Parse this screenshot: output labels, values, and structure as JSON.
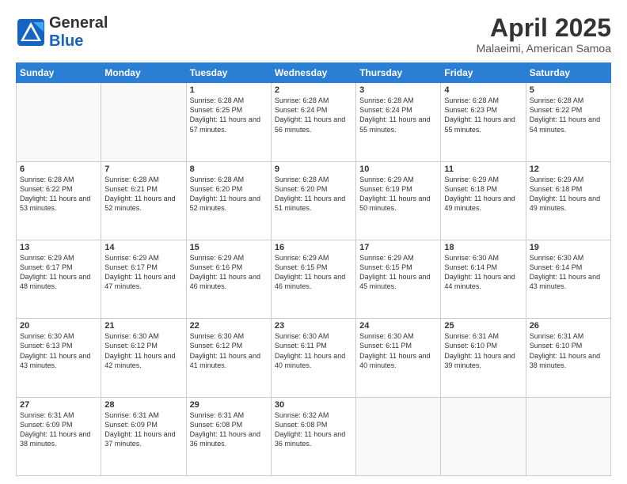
{
  "header": {
    "logo_general": "General",
    "logo_blue": "Blue",
    "month_title": "April 2025",
    "location": "Malaeimi, American Samoa"
  },
  "days_of_week": [
    "Sunday",
    "Monday",
    "Tuesday",
    "Wednesday",
    "Thursday",
    "Friday",
    "Saturday"
  ],
  "weeks": [
    [
      {
        "day": "",
        "info": ""
      },
      {
        "day": "",
        "info": ""
      },
      {
        "day": "1",
        "info": "Sunrise: 6:28 AM\nSunset: 6:25 PM\nDaylight: 11 hours and 57 minutes."
      },
      {
        "day": "2",
        "info": "Sunrise: 6:28 AM\nSunset: 6:24 PM\nDaylight: 11 hours and 56 minutes."
      },
      {
        "day": "3",
        "info": "Sunrise: 6:28 AM\nSunset: 6:24 PM\nDaylight: 11 hours and 55 minutes."
      },
      {
        "day": "4",
        "info": "Sunrise: 6:28 AM\nSunset: 6:23 PM\nDaylight: 11 hours and 55 minutes."
      },
      {
        "day": "5",
        "info": "Sunrise: 6:28 AM\nSunset: 6:22 PM\nDaylight: 11 hours and 54 minutes."
      }
    ],
    [
      {
        "day": "6",
        "info": "Sunrise: 6:28 AM\nSunset: 6:22 PM\nDaylight: 11 hours and 53 minutes."
      },
      {
        "day": "7",
        "info": "Sunrise: 6:28 AM\nSunset: 6:21 PM\nDaylight: 11 hours and 52 minutes."
      },
      {
        "day": "8",
        "info": "Sunrise: 6:28 AM\nSunset: 6:20 PM\nDaylight: 11 hours and 52 minutes."
      },
      {
        "day": "9",
        "info": "Sunrise: 6:28 AM\nSunset: 6:20 PM\nDaylight: 11 hours and 51 minutes."
      },
      {
        "day": "10",
        "info": "Sunrise: 6:29 AM\nSunset: 6:19 PM\nDaylight: 11 hours and 50 minutes."
      },
      {
        "day": "11",
        "info": "Sunrise: 6:29 AM\nSunset: 6:18 PM\nDaylight: 11 hours and 49 minutes."
      },
      {
        "day": "12",
        "info": "Sunrise: 6:29 AM\nSunset: 6:18 PM\nDaylight: 11 hours and 49 minutes."
      }
    ],
    [
      {
        "day": "13",
        "info": "Sunrise: 6:29 AM\nSunset: 6:17 PM\nDaylight: 11 hours and 48 minutes."
      },
      {
        "day": "14",
        "info": "Sunrise: 6:29 AM\nSunset: 6:17 PM\nDaylight: 11 hours and 47 minutes."
      },
      {
        "day": "15",
        "info": "Sunrise: 6:29 AM\nSunset: 6:16 PM\nDaylight: 11 hours and 46 minutes."
      },
      {
        "day": "16",
        "info": "Sunrise: 6:29 AM\nSunset: 6:15 PM\nDaylight: 11 hours and 46 minutes."
      },
      {
        "day": "17",
        "info": "Sunrise: 6:29 AM\nSunset: 6:15 PM\nDaylight: 11 hours and 45 minutes."
      },
      {
        "day": "18",
        "info": "Sunrise: 6:30 AM\nSunset: 6:14 PM\nDaylight: 11 hours and 44 minutes."
      },
      {
        "day": "19",
        "info": "Sunrise: 6:30 AM\nSunset: 6:14 PM\nDaylight: 11 hours and 43 minutes."
      }
    ],
    [
      {
        "day": "20",
        "info": "Sunrise: 6:30 AM\nSunset: 6:13 PM\nDaylight: 11 hours and 43 minutes."
      },
      {
        "day": "21",
        "info": "Sunrise: 6:30 AM\nSunset: 6:12 PM\nDaylight: 11 hours and 42 minutes."
      },
      {
        "day": "22",
        "info": "Sunrise: 6:30 AM\nSunset: 6:12 PM\nDaylight: 11 hours and 41 minutes."
      },
      {
        "day": "23",
        "info": "Sunrise: 6:30 AM\nSunset: 6:11 PM\nDaylight: 11 hours and 40 minutes."
      },
      {
        "day": "24",
        "info": "Sunrise: 6:30 AM\nSunset: 6:11 PM\nDaylight: 11 hours and 40 minutes."
      },
      {
        "day": "25",
        "info": "Sunrise: 6:31 AM\nSunset: 6:10 PM\nDaylight: 11 hours and 39 minutes."
      },
      {
        "day": "26",
        "info": "Sunrise: 6:31 AM\nSunset: 6:10 PM\nDaylight: 11 hours and 38 minutes."
      }
    ],
    [
      {
        "day": "27",
        "info": "Sunrise: 6:31 AM\nSunset: 6:09 PM\nDaylight: 11 hours and 38 minutes."
      },
      {
        "day": "28",
        "info": "Sunrise: 6:31 AM\nSunset: 6:09 PM\nDaylight: 11 hours and 37 minutes."
      },
      {
        "day": "29",
        "info": "Sunrise: 6:31 AM\nSunset: 6:08 PM\nDaylight: 11 hours and 36 minutes."
      },
      {
        "day": "30",
        "info": "Sunrise: 6:32 AM\nSunset: 6:08 PM\nDaylight: 11 hours and 36 minutes."
      },
      {
        "day": "",
        "info": ""
      },
      {
        "day": "",
        "info": ""
      },
      {
        "day": "",
        "info": ""
      }
    ]
  ]
}
